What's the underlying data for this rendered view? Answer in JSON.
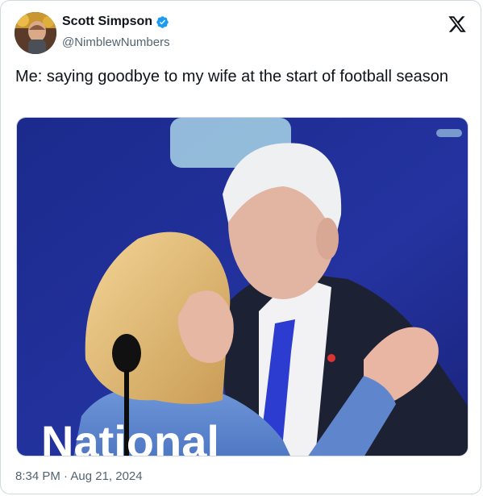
{
  "author": {
    "name": "Scott Simpson",
    "handle": "@NimblewNumbers",
    "verified_badge_icon": "verified-check-icon",
    "avatar_icon": "profile-photo"
  },
  "platform": {
    "logo_icon": "x-logo-icon"
  },
  "tweet": {
    "text": "Me: saying goodbye to my wife at the start of football season",
    "timestamp": "8:34 PM · Aug 21, 2024"
  },
  "media": {
    "description_icon": "embedded-photo",
    "banner_text": "National"
  },
  "colors": {
    "verified": "#1d9bf0",
    "text_primary": "#0f1419",
    "text_secondary": "#536471",
    "border": "#cfd9de"
  }
}
